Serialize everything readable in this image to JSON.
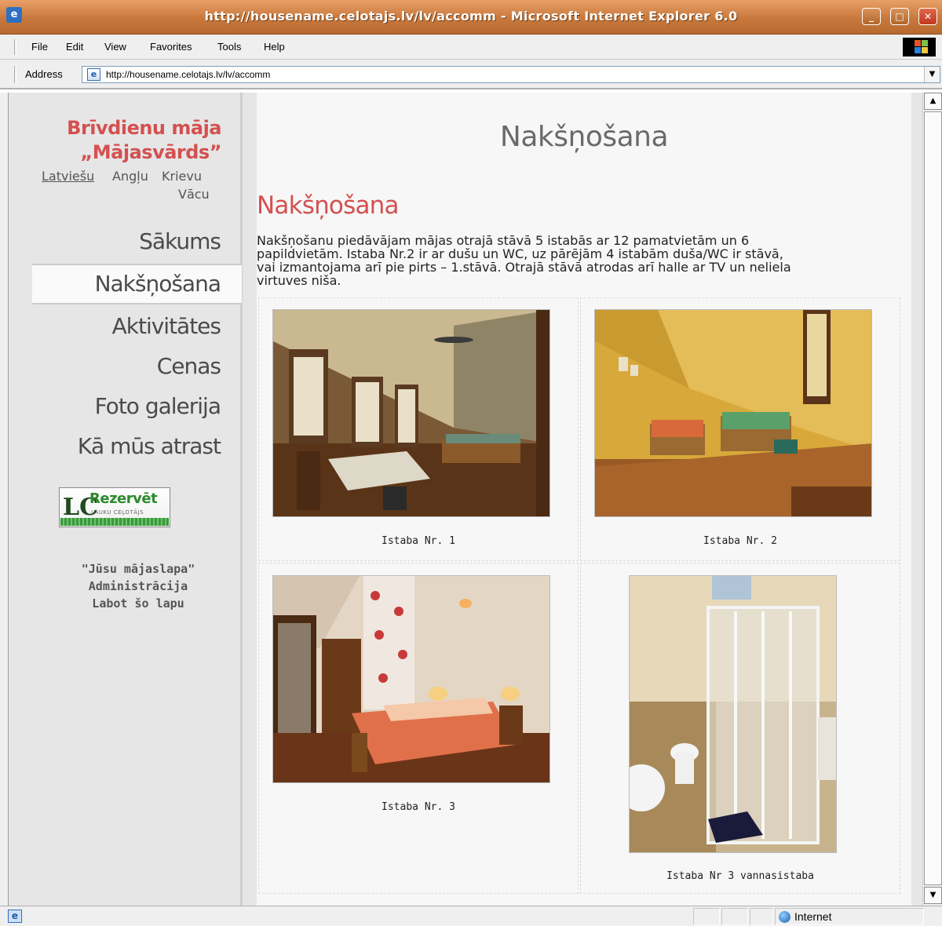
{
  "window": {
    "title": "http://housename.celotajs.lv/lv/accomm - Microsoft Internet Explorer 6.0",
    "minimize_glyph": "_",
    "maximize_glyph": "□",
    "close_glyph": "✕"
  },
  "menu": {
    "items": [
      "File",
      "Edit",
      "View",
      "Favorites",
      "Tools",
      "Help"
    ]
  },
  "address": {
    "label": "Address",
    "url": "http://housename.celotajs.lv/lv/accomm"
  },
  "sidebar": {
    "site_title_line1": "Brīvdienu māja",
    "site_title_line2": "„Mājasvārds”",
    "languages": [
      "Latviešu",
      "Angļu",
      "Krievu",
      "Vācu"
    ],
    "nav": [
      "Sākums",
      "Nakšņošana",
      "Aktivitātes",
      "Cenas",
      "Foto galerija",
      "Kā mūs atrast"
    ],
    "active_nav": "Nakšņošana",
    "reserve_button": {
      "label": "Rezervēt",
      "sub": "LAUKU CEĻOTĀJS",
      "mark": "LC"
    },
    "links": [
      "\"Jūsu mājaslapa\"",
      "Administrācija",
      "Labot šo lapu"
    ]
  },
  "main": {
    "heading": "Nakšņošana",
    "subheading": "Nakšņošana",
    "intro_lines": [
      "Nakšņošanu piedāvājam mājas otrajā stāvā 5 istabās ar 12 pamatvietām un 6",
      "papildvietām. Istaba Nr.2 ir ar dušu un WC, uz pārējām 4 istabām duša/WC ir stāvā,",
      "vai izmantojama arī pie pirts – 1.stāvā. Otrajā stāvā atrodas arī halle ar TV un neliela",
      "virtuves niša."
    ],
    "gallery": [
      {
        "caption": "Istaba Nr. 1"
      },
      {
        "caption": "Istaba Nr. 2"
      },
      {
        "caption": "Istaba Nr. 3"
      },
      {
        "caption": "Istaba Nr 3 vannasistaba"
      }
    ]
  },
  "status": {
    "zone": "Internet"
  },
  "colors": {
    "accent_red": "#d45050",
    "sidebar_bg": "#e6e6e6",
    "titlebar": "#c8783c"
  }
}
